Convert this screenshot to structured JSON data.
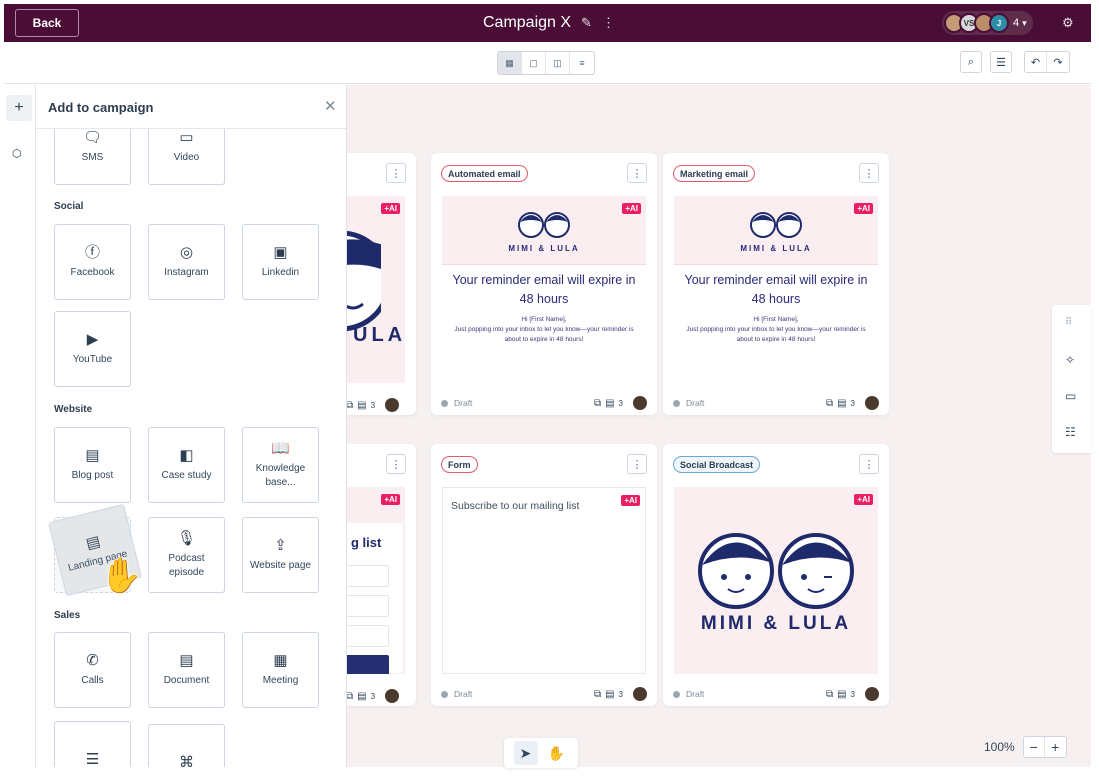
{
  "topbar": {
    "back_label": "Back",
    "title": "Campaign X",
    "edit_icon": "pencil-icon",
    "more_icon": "more-icon",
    "avatar_initials": [
      "",
      "VS",
      "",
      "J"
    ],
    "avatar_count": "4",
    "accent": "#4a0e36"
  },
  "toolbar": {
    "view_icons": [
      "board-view-icon",
      "card-view-icon",
      "layout-view-icon",
      "list-view-icon"
    ],
    "search_icon": "search-icon",
    "filter_icon": "filter-icon",
    "undo_icon": "undo-icon",
    "redo_icon": "redo-icon"
  },
  "panel": {
    "title": "Add to campaign",
    "sections": {
      "social": "Social",
      "website": "Website",
      "sales": "Sales"
    },
    "tiles": {
      "sms": "SMS",
      "video": "Video",
      "facebook": "Facebook",
      "instagram": "Instagram",
      "linkedin": "Linkedin",
      "youtube": "YouTube",
      "blog_post": "Blog post",
      "case_study": "Case study",
      "knowledge_base": "Knowledge base...",
      "landing_page": "Landing page",
      "podcast_episode": "Podcast episode",
      "website_page": "Website page",
      "calls": "Calls",
      "document": "Document",
      "meeting": "Meeting"
    }
  },
  "cards": [
    {
      "tag": "Automated email",
      "ai": "+AI",
      "logo": "MIMI & LULA",
      "heading": "Your reminder email will expire in 48 hours",
      "greeting": "Hi [First Name],",
      "body": "Just popping into your inbox to let you know—your reminder is about to expire in 48 hours!",
      "status": "Draft",
      "comments": "3"
    },
    {
      "tag": "Marketing email",
      "ai": "+AI",
      "logo": "MIMI & LULA",
      "heading": "Your reminder email will expire in 48 hours",
      "greeting": "Hi [First Name],",
      "body": "Just popping into your inbox to let you know—your reminder is about to expire in 48 hours!",
      "status": "Draft",
      "comments": "3"
    },
    {
      "tag": "Form",
      "ai": "+AI",
      "text": "Subscribe to our mailing list",
      "status": "Draft",
      "comments": "3"
    },
    {
      "tag": "Social Broadcast",
      "ai": "+AI",
      "logo": "MIMI & LULA",
      "status": "Draft",
      "comments": "3"
    }
  ],
  "partial_cards": {
    "ai": "+AI",
    "logo_fragment": "ULA",
    "form_fragment": "g list",
    "comments": "3"
  },
  "zoom": {
    "level": "100%",
    "minus": "−",
    "plus": "+"
  },
  "colors": {
    "ai": "#e91e63",
    "tag_red": "#e05a6d",
    "tag_blue": "#6aa7d8",
    "canvas": "#f6f1f0"
  }
}
